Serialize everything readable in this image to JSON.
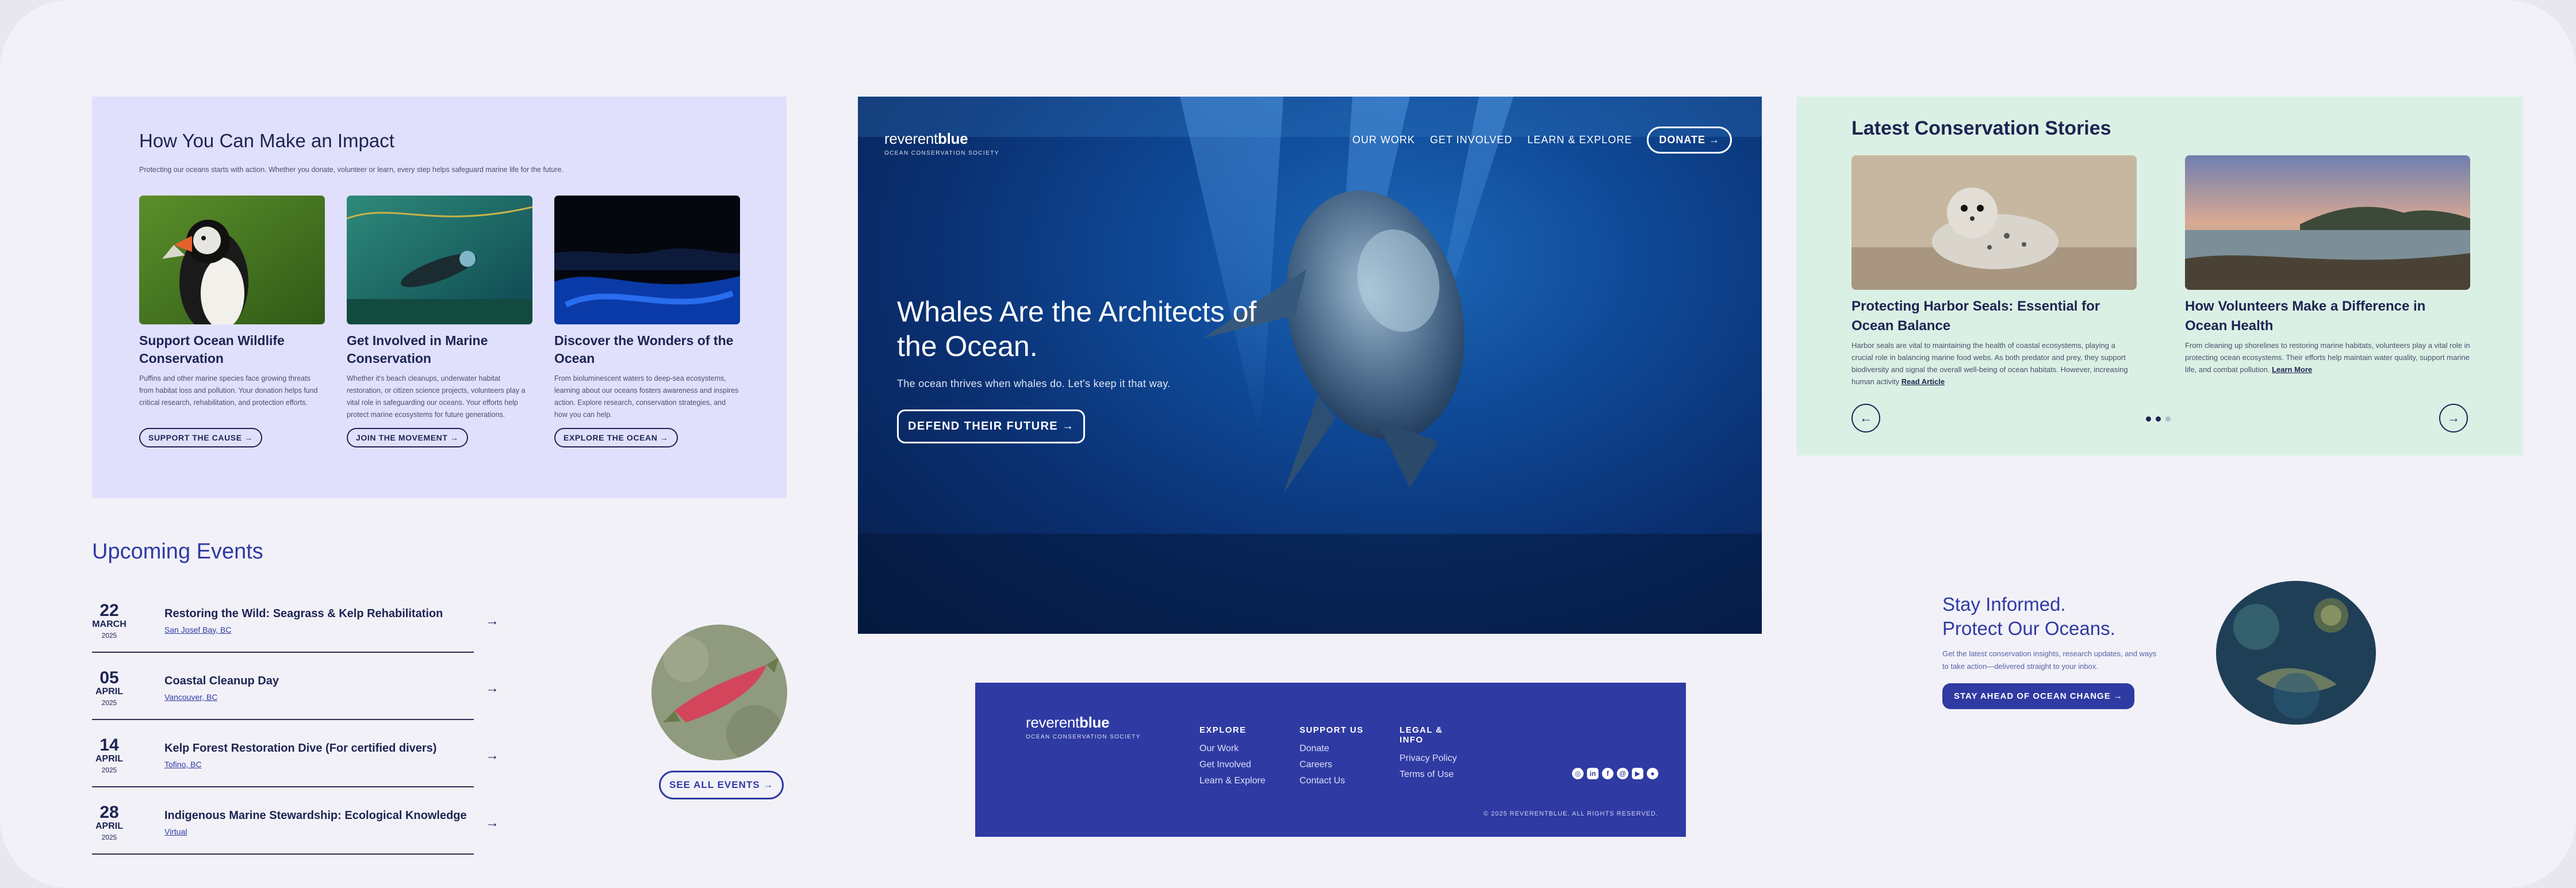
{
  "impact": {
    "title": "How You Can Make an Impact",
    "intro": "Protecting our oceans starts with action. Whether you donate, volunteer or learn, every step helps safeguard marine life for the future.",
    "cards": [
      {
        "title": "Support Ocean Wildlife Conservation",
        "text": "Puffins and other marine species face growing threats from habitat loss and pollution. Your donation helps fund critical research, rehabilitation, and protection efforts.",
        "cta": "SUPPORT THE CAUSE →"
      },
      {
        "title": "Get Involved in Marine Conservation",
        "text": "Whether it's beach cleanups, underwater habitat restoration, or citizen science projects, volunteers play a vital role in safeguarding our oceans. Your efforts help protect marine ecosystems for future generations.",
        "cta": "JOIN THE MOVEMENT →"
      },
      {
        "title": "Discover the Wonders of the Ocean",
        "text": "From bioluminescent waters to deep-sea ecosystems, learning about our oceans fosters awareness and inspires action. Explore research, conservation strategies, and how you can help.",
        "cta": "EXPLORE THE OCEAN →"
      }
    ]
  },
  "events": {
    "title": "Upcoming Events",
    "items": [
      {
        "day": "22",
        "month": "MARCH",
        "year": "2025",
        "title": "Restoring the Wild: Seagrass & Kelp Rehabilitation",
        "location": "San Josef Bay, BC"
      },
      {
        "day": "05",
        "month": "APRIL",
        "year": "2025",
        "title": "Coastal Cleanup Day",
        "location": "Vancouver, BC"
      },
      {
        "day": "14",
        "month": "APRIL",
        "year": "2025",
        "title": "Kelp Forest Restoration Dive   (For certified divers)",
        "location": "Tofino, BC"
      },
      {
        "day": "28",
        "month": "APRIL",
        "year": "2025",
        "title": "Indigenous Marine Stewardship: Ecological Knowledge",
        "location": "Virtual"
      }
    ],
    "see_all": "SEE ALL EVENTS →"
  },
  "hero": {
    "logo_word_light": "reverent",
    "logo_word_bold": "blue",
    "logo_sub": "OCEAN CONSERVATION SOCIETY",
    "nav": [
      "OUR WORK",
      "GET INVOLVED",
      "LEARN & EXPLORE"
    ],
    "donate": "DONATE →",
    "title": "Whales Are the Architects of the Ocean.",
    "subtitle": "The ocean thrives when whales do. Let's keep it that way.",
    "cta": "DEFEND THEIR FUTURE →"
  },
  "stories": {
    "title": "Latest Conservation Stories",
    "cards": [
      {
        "title": "Protecting Harbor Seals: Essential for Ocean Balance",
        "text": "Harbor seals are vital to maintaining the health of coastal ecosystems, playing a crucial role in balancing marine food webs. As both predator and prey, they support biodiversity and signal the overall well-being of ocean habitats. However, increasing human activity",
        "link": "Read Article"
      },
      {
        "title": "How Volunteers Make a Difference in Ocean Health",
        "text": "From cleaning up shorelines to restoring marine habitats, volunteers play a vital role in protecting ocean ecosystems. Their efforts help maintain water quality, support marine life, and combat pollution.",
        "link": "Learn More"
      }
    ],
    "prev": "←",
    "next": "→"
  },
  "subscribe": {
    "title_line1": "Stay Informed.",
    "title_line2": "Protect Our Oceans.",
    "text": "Get the latest conservation insights, research updates, and ways to take action—delivered straight to your inbox.",
    "cta": "STAY AHEAD OF OCEAN CHANGE →"
  },
  "footer": {
    "logo_word_light": "reverent",
    "logo_word_bold": "blue",
    "logo_sub": "OCEAN CONSERVATION SOCIETY",
    "columns": [
      {
        "heading": "EXPLORE",
        "links": [
          "Our Work",
          "Get Involved",
          "Learn & Explore"
        ]
      },
      {
        "heading": "SUPPORT US",
        "links": [
          "Donate",
          "Careers",
          "Contact Us"
        ]
      },
      {
        "heading": "LEGAL & INFO",
        "links": [
          "Privacy Policy",
          "Terms of Use"
        ]
      }
    ],
    "social_icons": [
      "instagram-icon",
      "linkedin-icon",
      "facebook-icon",
      "threads-icon",
      "youtube-icon",
      "reddit-icon"
    ],
    "copyright": "© 2025 REVERENTBLUE. ALL RIGHTS RESERVED."
  },
  "colors": {
    "navy": "#1d2452",
    "brand_blue": "#2f3aa3",
    "impact_bg": "#e0e0fc",
    "stories_bg": "#dbf0e4",
    "page_bg": "#f2f1f8"
  }
}
